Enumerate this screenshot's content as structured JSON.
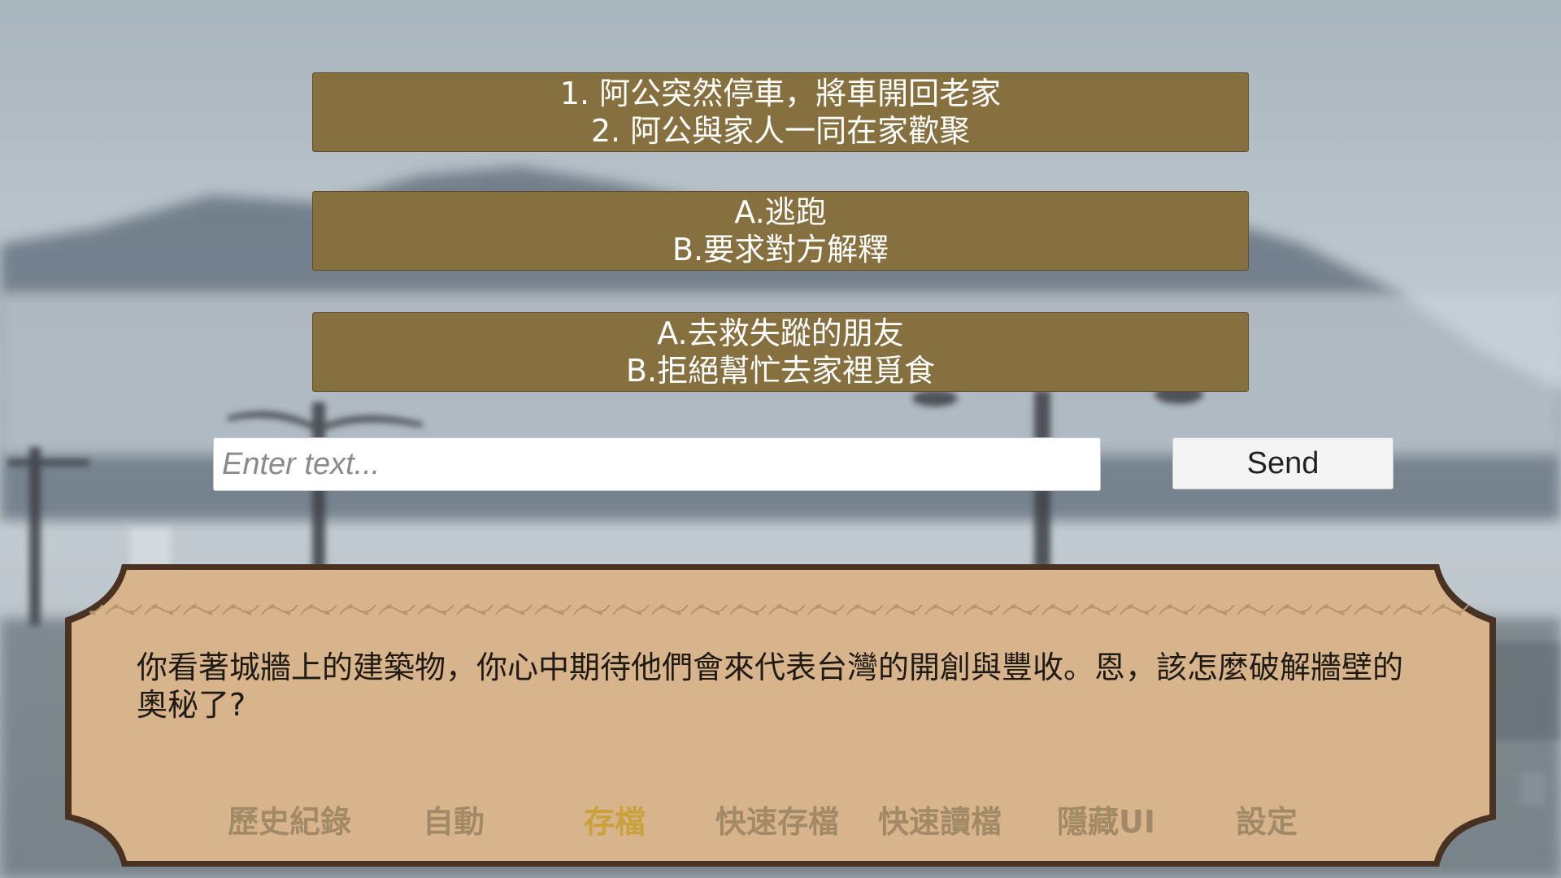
{
  "choices": [
    {
      "line1": "1. 阿公突然停車，將車開回老家",
      "line2": "2. 阿公與家人一同在家歡聚"
    },
    {
      "line1": "A.逃跑",
      "line2": "B.要求對方解釋"
    },
    {
      "line1": "A.去救失蹤的朋友",
      "line2": "B.拒絕幫忙去家裡覓食"
    }
  ],
  "input": {
    "placeholder": "Enter text...",
    "value": ""
  },
  "send_label": "Send",
  "dialog": {
    "text": "你看著城牆上的建築物，你心中期待他們會來代表台灣的開創與豐收。恩，該怎麼破解牆壁的奧秘了?"
  },
  "menu": {
    "history": "歷史紀錄",
    "auto": "自動",
    "save": "存檔",
    "quick_save": "快速存檔",
    "quick_load": "快速讀檔",
    "hide_ui": "隱藏UI",
    "settings": "設定"
  },
  "colors": {
    "choice_bg": "#86703f",
    "panel_bg": "#d7b48c",
    "panel_border": "#4a3222",
    "menu_text": "#a38a67",
    "menu_active": "#c9a23c"
  }
}
